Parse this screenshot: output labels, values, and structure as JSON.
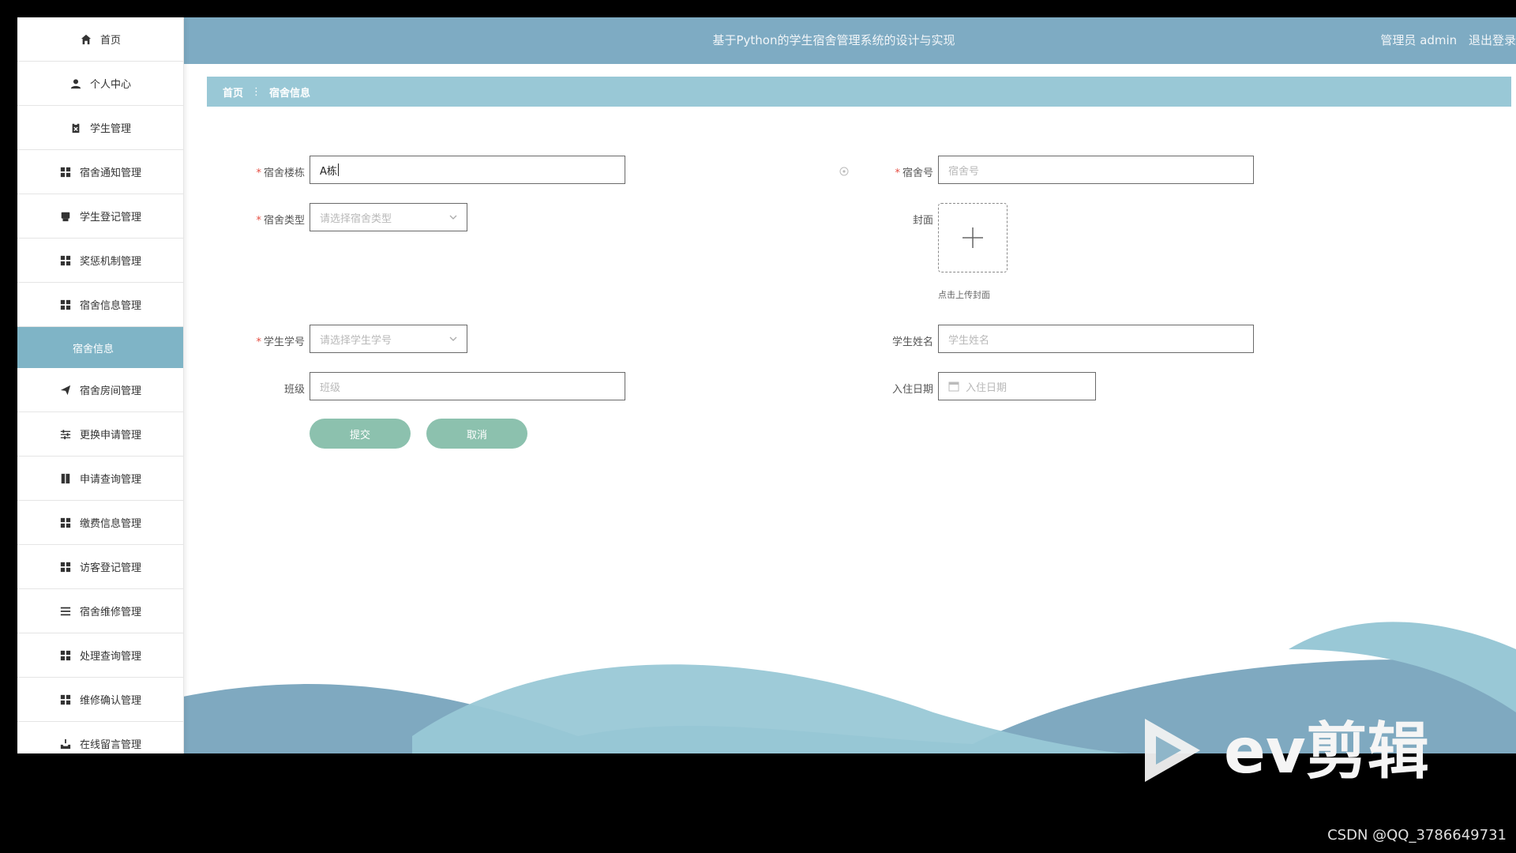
{
  "header": {
    "title": "基于Python的学生宿舍管理系统的设计与实现",
    "user_label": "管理员 admin",
    "logout_label": "退出登录"
  },
  "sidebar": {
    "items": [
      {
        "label": "首页",
        "icon": "home-icon"
      },
      {
        "label": "个人中心",
        "icon": "user-icon"
      },
      {
        "label": "学生管理",
        "icon": "clipboard-icon"
      },
      {
        "label": "宿舍通知管理",
        "icon": "grid-icon"
      },
      {
        "label": "学生登记管理",
        "icon": "printer-icon"
      },
      {
        "label": "奖惩机制管理",
        "icon": "grid-icon"
      },
      {
        "label": "宿舍信息管理",
        "icon": "grid-icon"
      },
      {
        "label": "宿舍信息",
        "icon": "",
        "sub": true
      },
      {
        "label": "宿舍房间管理",
        "icon": "send-icon"
      },
      {
        "label": "更换申请管理",
        "icon": "sliders-icon"
      },
      {
        "label": "申请查询管理",
        "icon": "book-icon"
      },
      {
        "label": "缴费信息管理",
        "icon": "grid-icon"
      },
      {
        "label": "访客登记管理",
        "icon": "grid-icon"
      },
      {
        "label": "宿舍维修管理",
        "icon": "list-icon"
      },
      {
        "label": "处理查询管理",
        "icon": "grid-icon"
      },
      {
        "label": "维修确认管理",
        "icon": "grid-icon"
      },
      {
        "label": "在线留言管理",
        "icon": "inbox-icon"
      }
    ]
  },
  "breadcrumb": {
    "home": "首页",
    "separator": "⋮",
    "current": "宿舍信息"
  },
  "form": {
    "building": {
      "label": "宿舍楼栋",
      "value": "A栋"
    },
    "room_no": {
      "label": "宿舍号",
      "placeholder": "宿舍号"
    },
    "room_type": {
      "label": "宿舍类型",
      "placeholder": "请选择宿舍类型"
    },
    "cover": {
      "label": "封面",
      "tip": "点击上传封面"
    },
    "student_id": {
      "label": "学生学号",
      "placeholder": "请选择学生学号"
    },
    "student_name": {
      "label": "学生姓名",
      "placeholder": "学生姓名"
    },
    "class": {
      "label": "班级",
      "placeholder": "班级"
    },
    "checkin_date": {
      "label": "入住日期",
      "placeholder": "入住日期"
    },
    "submit_label": "提交",
    "cancel_label": "取消"
  },
  "overlay": {
    "watermark_text": "ev剪辑",
    "credit": "CSDN @QQ_3786649731"
  },
  "colors": {
    "topbar": "#7eabc3",
    "breadcrumb": "#99c8d6",
    "sidebar_active": "#7fb4c6",
    "button": "#8cc1ae",
    "required": "#e54d42"
  }
}
